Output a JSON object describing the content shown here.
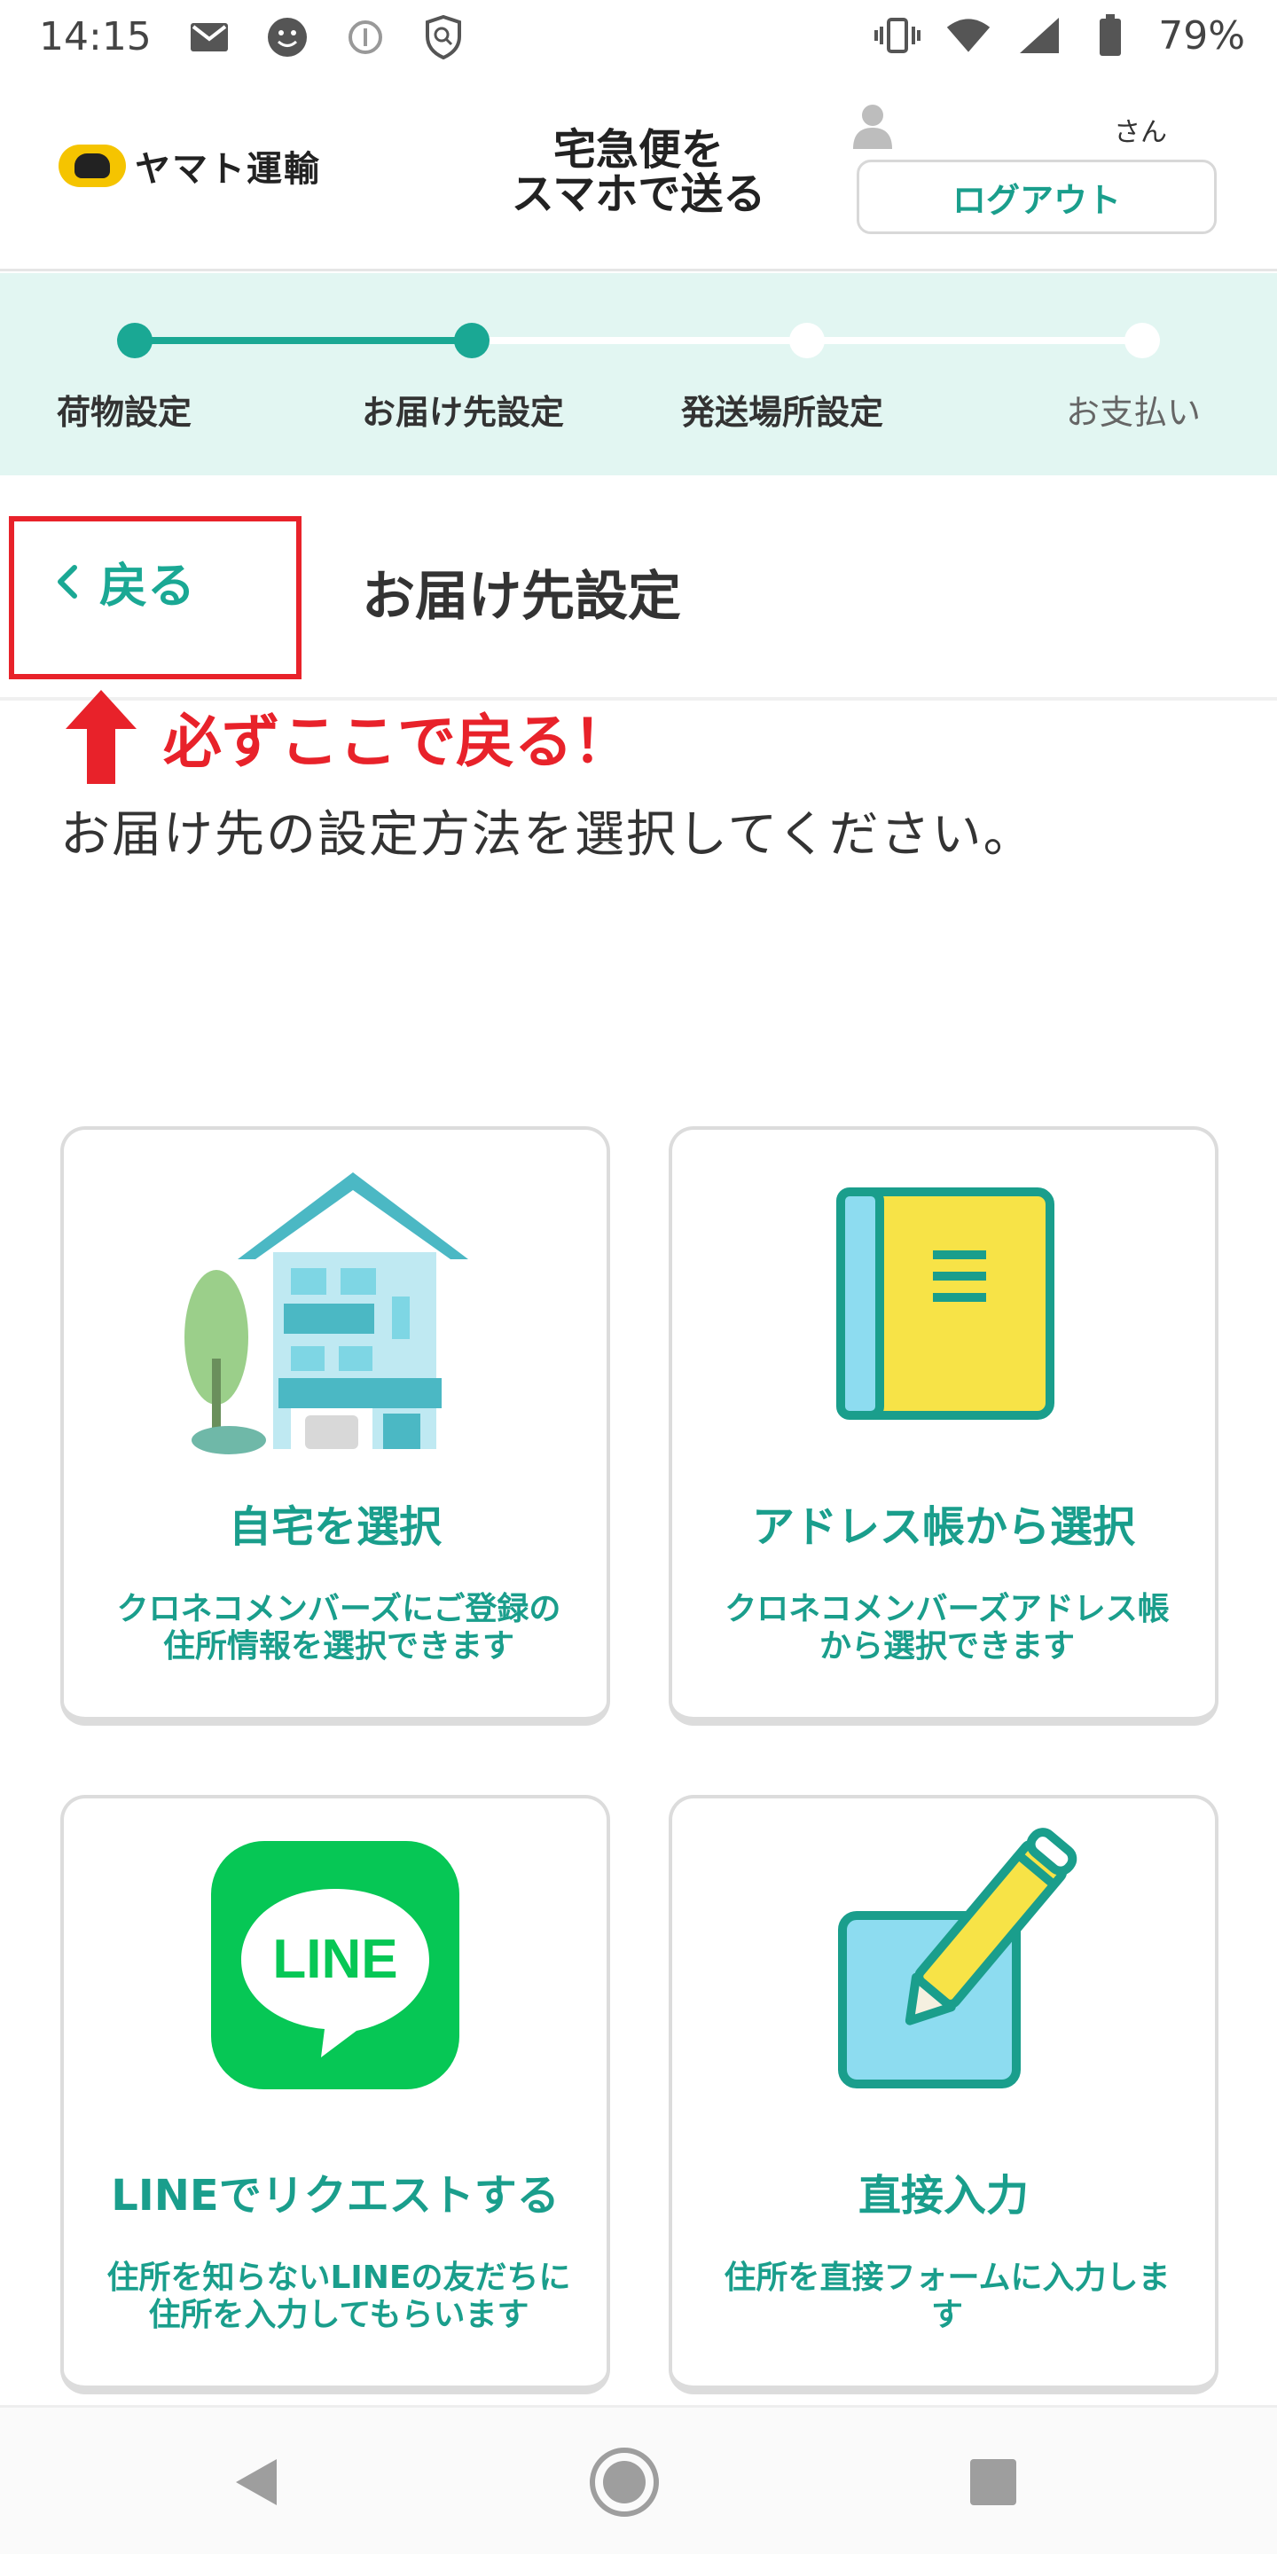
{
  "status_bar": {
    "time": "14:15",
    "left_icons": [
      "gmail-icon",
      "face-icon",
      "info-icon",
      "vpn-shield-icon"
    ],
    "right_icons": [
      "vibrate-icon",
      "wifi-icon",
      "signal-icon",
      "battery-icon"
    ],
    "battery": "79%"
  },
  "header": {
    "brand": "ヤマト運輸",
    "service_title_line1": "宅急便を",
    "service_title_line2": "スマホで送る",
    "user_suffix": "さん",
    "logout_label": "ログアウト"
  },
  "stepper": {
    "steps": [
      {
        "label": "荷物設定",
        "state": "done"
      },
      {
        "label": "お届け先設定",
        "state": "current"
      },
      {
        "label": "発送場所設定",
        "state": "todo"
      },
      {
        "label": "お支払い",
        "state": "todo"
      }
    ]
  },
  "page": {
    "back_label": "戻る",
    "title": "お届け先設定",
    "annotation": "必ずここで戻る！",
    "instruction": "お届け先の設定方法を選択してください。"
  },
  "options": [
    {
      "title": "自宅を選択",
      "desc_line1": "クロネコメンバーズにご登録の",
      "desc_line2": "住所情報を選択できます",
      "icon": "house-icon"
    },
    {
      "title": "アドレス帳から選択",
      "desc_line1": "クロネコメンバーズアドレス帳",
      "desc_line2": "から選択できます",
      "icon": "address-book-icon"
    },
    {
      "title": "LINEでリクエストする",
      "desc_line1": "住所を知らないLINEの友だちに",
      "desc_line2": "住所を入力してもらいます",
      "icon": "line-icon",
      "logo_text": "LINE"
    },
    {
      "title": "直接入力",
      "desc_line1": "住所を直接フォームに入力しま",
      "desc_line2": "す",
      "icon": "pencil-form-icon"
    }
  ],
  "colors": {
    "accent": "#1aa894",
    "accent_text": "#1a9e8c",
    "stepper_bg": "#e2f6f2",
    "annotation_red": "#e8222a",
    "line_green": "#06c755"
  },
  "nav": {
    "icons": [
      "back-nav-icon",
      "home-nav-icon",
      "recents-nav-icon"
    ]
  }
}
